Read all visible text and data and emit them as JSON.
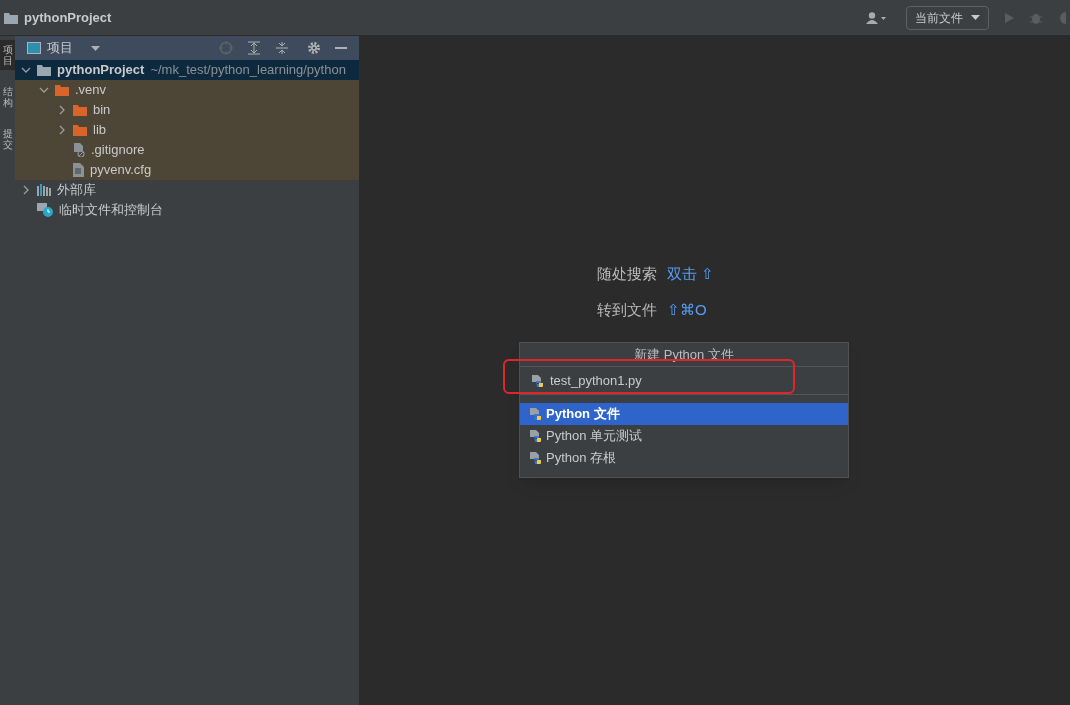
{
  "window": {
    "title": "pythonProject"
  },
  "toolbar": {
    "run_config": "当前文件"
  },
  "side_tabs": [
    {
      "label": "项目",
      "selected": true
    },
    {
      "label": "结构",
      "selected": false
    },
    {
      "label": "提交",
      "selected": false
    }
  ],
  "project_panel": {
    "title": "项目",
    "tree": [
      {
        "label": "pythonProject",
        "path": "~/mk_test/python_learning/python",
        "kind": "folder",
        "expanded": true,
        "selected": true,
        "children": [
          {
            "label": ".venv",
            "kind": "orange-folder",
            "expanded": true,
            "selected": false,
            "children": [
              {
                "label": "bin",
                "kind": "orange-folder",
                "expanded": false,
                "selected": false
              },
              {
                "label": "lib",
                "kind": "orange-folder",
                "expanded": false,
                "selected": false
              },
              {
                "label": ".gitignore",
                "kind": "ignore-file",
                "selected": false
              },
              {
                "label": "pyvenv.cfg",
                "kind": "text-file",
                "selected": false
              }
            ]
          }
        ]
      },
      {
        "label": "外部库",
        "kind": "library",
        "expanded": false,
        "selected": false
      },
      {
        "label": "临时文件和控制台",
        "kind": "scratch",
        "selected": false
      }
    ]
  },
  "editor_hints": [
    {
      "label": "随处搜索",
      "shortcut": "双击 ⇧"
    },
    {
      "label": "转到文件",
      "shortcut": "⇧⌘O"
    }
  ],
  "new_file_popup": {
    "title": "新建 Python 文件",
    "value": "test_python1.py",
    "options": [
      {
        "label": "Python 文件",
        "selected": true
      },
      {
        "label": "Python 单元测试",
        "selected": false
      },
      {
        "label": "Python 存根",
        "selected": false
      }
    ]
  }
}
